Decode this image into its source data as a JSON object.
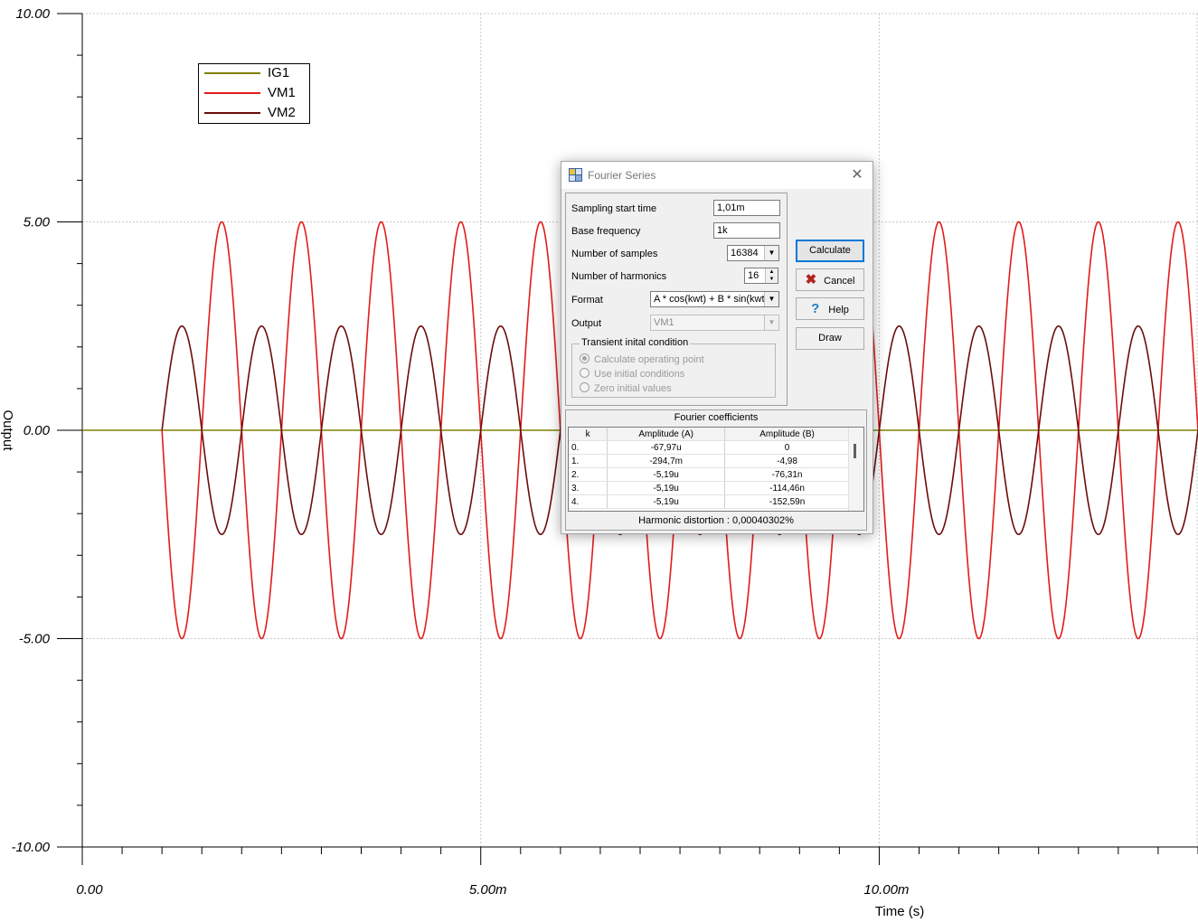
{
  "chart_data": {
    "type": "line",
    "ylabel": "Output",
    "xlabel": "Time (s)",
    "ylim": [
      -10,
      10
    ],
    "xlim": [
      0,
      0.014
    ],
    "y_ticks": [
      "10.00",
      "5.00",
      "0.00",
      "-5.00",
      "-10.00"
    ],
    "x_ticks": [
      "0.00",
      "5.00m",
      "10.00m"
    ],
    "grid": true,
    "legend_placement": "top-left",
    "series": [
      {
        "name": "IG1",
        "color": "#808000",
        "shape": "constant",
        "value": 0,
        "t_start": 0,
        "t_end": 0.014
      },
      {
        "name": "VM1",
        "color": "#e31b1b",
        "shape": "sine",
        "amplitude": 5,
        "frequency_hz": 1000,
        "phase": "negative-sine",
        "t_start": 0.001,
        "t_end": 0.014
      },
      {
        "name": "VM2",
        "color": "#6b0c0c",
        "shape": "sine",
        "amplitude": 2.5,
        "frequency_hz": 1000,
        "phase": "positive-sine",
        "t_start": 0.001,
        "t_end": 0.014
      }
    ]
  },
  "dialog": {
    "title": "Fourier Series",
    "close_symbol": "✕",
    "fields": {
      "sampling_start_time_label": "Sampling start time",
      "sampling_start_time": "1,01m",
      "base_frequency_label": "Base frequency",
      "base_frequency": "1k",
      "number_of_samples_label": "Number of samples",
      "number_of_samples": "16384",
      "number_of_harmonics_label": "Number of harmonics",
      "number_of_harmonics": "16",
      "format_label": "Format",
      "format": "A * cos(kwt) + B * sin(kwt)",
      "output_label": "Output",
      "output": "VM1"
    },
    "transient": {
      "title": "Transient inital condition",
      "options": [
        "Calculate operating point",
        "Use initial conditions",
        "Zero initial values"
      ],
      "selected": "Calculate operating point"
    },
    "buttons": {
      "calculate": "Calculate",
      "cancel": "Cancel",
      "help": "Help",
      "draw": "Draw"
    },
    "coefficients": {
      "title": "Fourier coefficients",
      "columns": [
        "k",
        "Amplitude (A)",
        "Amplitude (B)"
      ],
      "rows": [
        [
          "0.",
          "-67,97u",
          "0"
        ],
        [
          "1.",
          "-294,7m",
          "-4,98"
        ],
        [
          "2.",
          "-5,19u",
          "-76,31n"
        ],
        [
          "3.",
          "-5,19u",
          "-114,46n"
        ],
        [
          "4.",
          "-5,19u",
          "-152,59n"
        ]
      ],
      "distortion_label": "Harmonic distortion :",
      "distortion_value": "0,00040302%"
    }
  }
}
